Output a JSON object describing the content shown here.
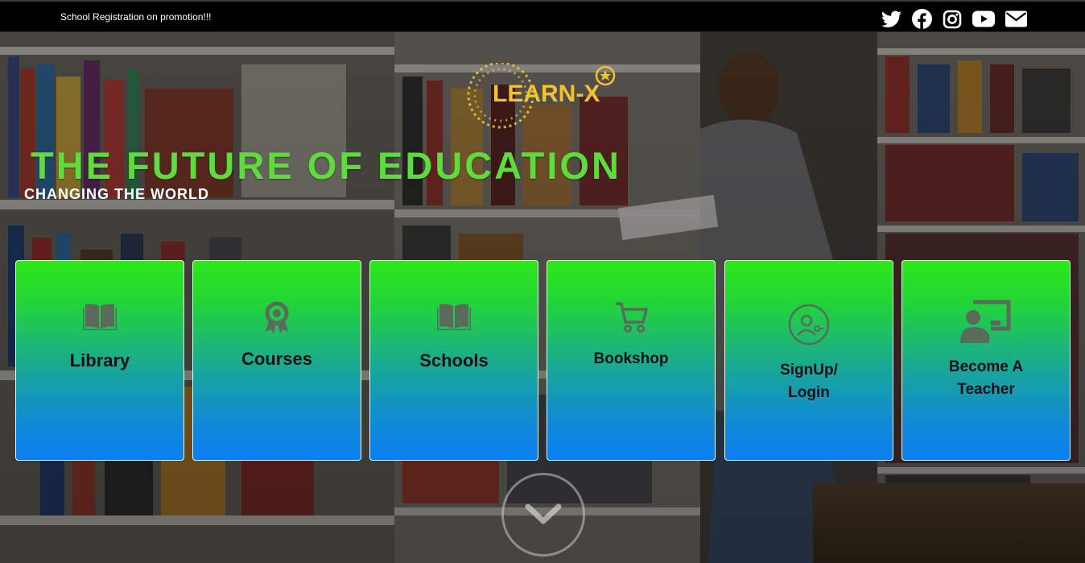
{
  "topbar": {
    "promo_text": "School Registration on promotion!!!",
    "social": [
      "twitter-icon",
      "facebook-icon",
      "instagram-icon",
      "youtube-icon",
      "envelope-icon"
    ]
  },
  "brand": {
    "logo_text": "LEARN-X",
    "logo_color": "#f2c230"
  },
  "hero": {
    "headline": "THE FUTURE OF EDUCATION",
    "headline_color": "#5ddc3c",
    "subheadline": "CHANGING THE WORLD"
  },
  "cards": [
    {
      "label": "Library",
      "icon": "book-open-icon"
    },
    {
      "label": "Courses",
      "icon": "award-icon"
    },
    {
      "label": "Schools",
      "icon": "book-open-icon"
    },
    {
      "label": "Bookshop",
      "icon": "cart-icon"
    },
    {
      "label_line1": "SignUp/",
      "label_line2": "Login",
      "icon": "user-login-icon"
    },
    {
      "label_line1": "Become A",
      "label_line2": "Teacher",
      "icon": "teacher-board-icon"
    }
  ],
  "scroll": {
    "icon": "chevron-down-icon"
  }
}
